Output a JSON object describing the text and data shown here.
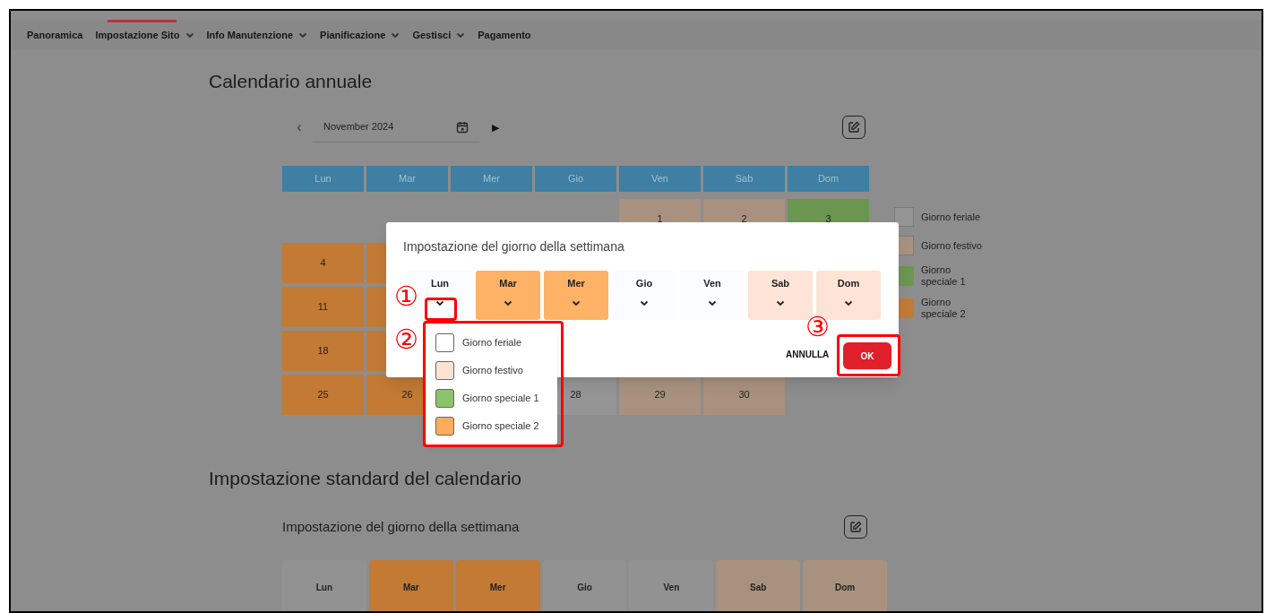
{
  "nav": [
    {
      "label": "Panoramica",
      "has_menu": false,
      "selected": false
    },
    {
      "label": "Impostazione Sito",
      "has_menu": true,
      "selected": true
    },
    {
      "label": "Info Manutenzione",
      "has_menu": true,
      "selected": false
    },
    {
      "label": "Pianificazione",
      "has_menu": true,
      "selected": false
    },
    {
      "label": "Gestisci",
      "has_menu": true,
      "selected": false
    },
    {
      "label": "Pagamento",
      "has_menu": false,
      "selected": false
    }
  ],
  "annual_calendar": {
    "title": "Calendario annuale",
    "month": "November 2024",
    "prev": "‹",
    "next": "▶",
    "weekdays": [
      "Lun",
      "Mar",
      "Mer",
      "Gio",
      "Ven",
      "Sab",
      "Dom"
    ],
    "weeks": [
      [
        {
          "kind": "empty"
        },
        {
          "kind": "empty"
        },
        {
          "kind": "empty"
        },
        {
          "kind": "empty"
        },
        {
          "kind": "festivo",
          "day": "1"
        },
        {
          "kind": "festivo",
          "day": "2"
        },
        {
          "kind": "speciale1",
          "day": "3"
        }
      ],
      [
        {
          "kind": "speciale2",
          "day": "4"
        },
        {
          "kind": "speciale2"
        },
        {
          "kind": "hidden"
        },
        {
          "kind": "hidden"
        },
        {
          "kind": "hidden"
        },
        {
          "kind": "hidden"
        },
        {
          "kind": "hidden"
        }
      ],
      [
        {
          "kind": "speciale2",
          "day": "11"
        },
        {
          "kind": "speciale2"
        },
        {
          "kind": "hidden"
        },
        {
          "kind": "hidden"
        },
        {
          "kind": "hidden"
        },
        {
          "kind": "hidden"
        },
        {
          "kind": "hidden"
        }
      ],
      [
        {
          "kind": "speciale2",
          "day": "18"
        },
        {
          "kind": "speciale2"
        },
        {
          "kind": "hidden"
        },
        {
          "kind": "hidden"
        },
        {
          "kind": "hidden"
        },
        {
          "kind": "hidden"
        },
        {
          "kind": "hidden"
        }
      ],
      [
        {
          "kind": "speciale2",
          "day": "25"
        },
        {
          "kind": "speciale2",
          "day": "26"
        },
        {
          "kind": "hidden"
        },
        {
          "kind": "feriale",
          "day": "28"
        },
        {
          "kind": "festivo",
          "day": "29"
        },
        {
          "kind": "festivo",
          "day": "30"
        },
        {
          "kind": "empty"
        }
      ]
    ],
    "legend": [
      {
        "kind": "feriale",
        "label": "Giorno feriale"
      },
      {
        "kind": "festivo",
        "label": "Giorno festivo"
      },
      {
        "kind": "speciale1",
        "label": "Giorno speciale 1"
      },
      {
        "kind": "speciale2",
        "label": "Giorno speciale 2"
      }
    ]
  },
  "standard_settings": {
    "title": "Impostazione standard del calendario",
    "subtitle": "Impostazione del giorno della settimana",
    "days": [
      {
        "label": "Lun",
        "kind": "feriale"
      },
      {
        "label": "Mar",
        "kind": "speciale2"
      },
      {
        "label": "Mer",
        "kind": "speciale2"
      },
      {
        "label": "Gio",
        "kind": "feriale"
      },
      {
        "label": "Ven",
        "kind": "feriale"
      },
      {
        "label": "Sab",
        "kind": "festivo"
      },
      {
        "label": "Dom",
        "kind": "festivo"
      }
    ]
  },
  "dialog": {
    "title": "Impostazione del giorno della settimana",
    "days": [
      {
        "label": "Lun",
        "kind": "feriale"
      },
      {
        "label": "Mar",
        "kind": "speciale2"
      },
      {
        "label": "Mer",
        "kind": "speciale2"
      },
      {
        "label": "Gio",
        "kind": "feriale"
      },
      {
        "label": "Ven",
        "kind": "feriale"
      },
      {
        "label": "Sab",
        "kind": "festivo"
      },
      {
        "label": "Dom",
        "kind": "festivo"
      }
    ],
    "options": [
      {
        "kind": "feriale",
        "label": "Giorno feriale"
      },
      {
        "kind": "festivo",
        "label": "Giorno festivo"
      },
      {
        "kind": "speciale1",
        "label": "Giorno speciale 1"
      },
      {
        "kind": "speciale2",
        "label": "Giorno speciale 2"
      }
    ],
    "cancel": "ANNULLA",
    "ok": "OK"
  },
  "annotations": [
    {
      "number": "①"
    },
    {
      "number": "②"
    },
    {
      "number": "③"
    }
  ]
}
